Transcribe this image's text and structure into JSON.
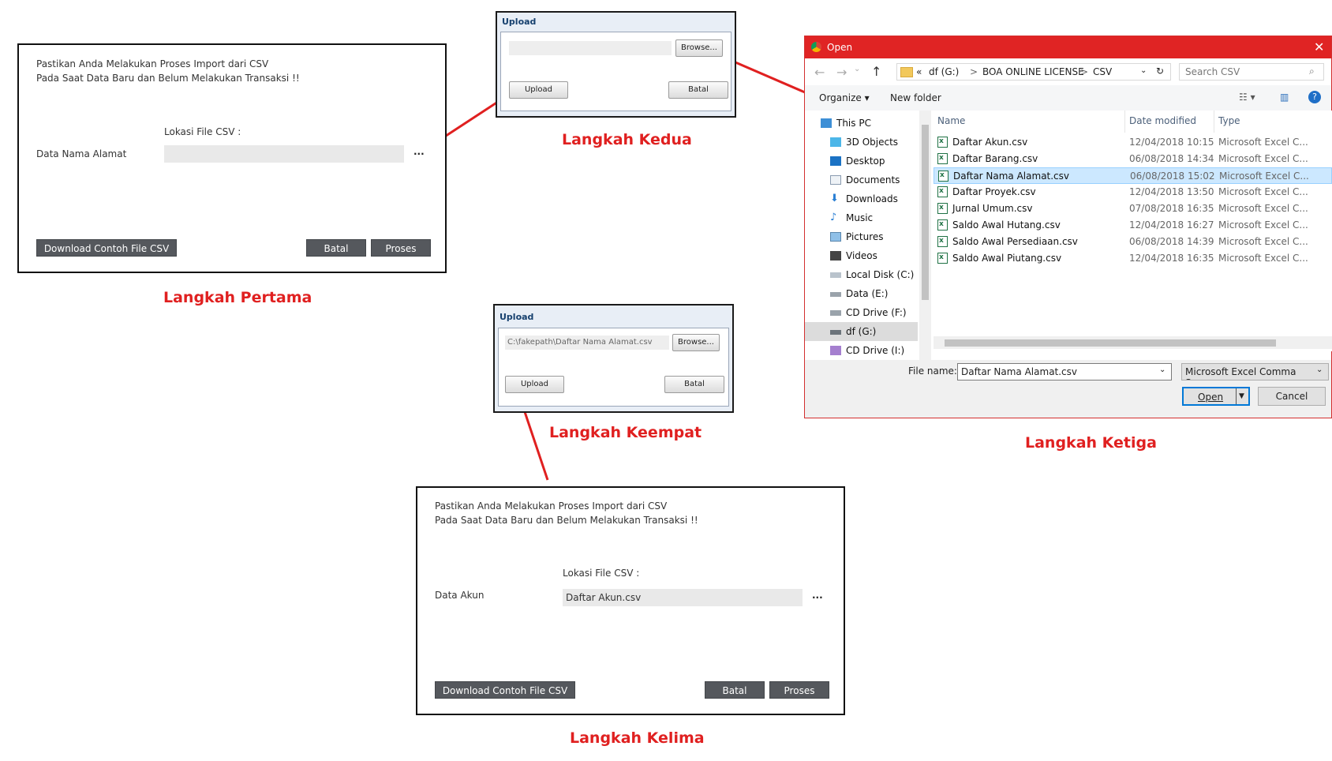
{
  "step1": {
    "line1": "Pastikan Anda Melakukan Proses Import dari CSV",
    "line2": "Pada Saat Data Baru dan Belum Melakukan Transaksi !!",
    "location_label": "Lokasi File CSV :",
    "data_label": "Data Nama Alamat",
    "field_value": "",
    "dots": "...",
    "download_button": "Download Contoh File CSV",
    "cancel_button": "Batal",
    "process_button": "Proses",
    "caption": "Langkah Pertama"
  },
  "step2": {
    "title": "Upload",
    "browse_button": "Browse...",
    "upload_button": "Upload",
    "cancel_button": "Batal",
    "field_value": "",
    "caption": "Langkah Kedua"
  },
  "step3": {
    "window_title": "Open",
    "breadcrumb": [
      "«",
      "df (G:)",
      ">",
      "BOA ONLINE LICENSE",
      ">",
      "CSV"
    ],
    "search_placeholder": "Search CSV",
    "organize": "Organize ▾",
    "new_folder": "New folder",
    "nav_items": [
      {
        "label": "This PC",
        "icon": "pc-icon"
      },
      {
        "label": "3D Objects",
        "icon": "cube-icon"
      },
      {
        "label": "Desktop",
        "icon": "desktop-icon"
      },
      {
        "label": "Documents",
        "icon": "documents-icon"
      },
      {
        "label": "Downloads",
        "icon": "download-icon"
      },
      {
        "label": "Music",
        "icon": "music-icon"
      },
      {
        "label": "Pictures",
        "icon": "pictures-icon"
      },
      {
        "label": "Videos",
        "icon": "videos-icon"
      },
      {
        "label": "Local Disk (C:)",
        "icon": "disk-icon"
      },
      {
        "label": "Data (E:)",
        "icon": "drive-icon"
      },
      {
        "label": "CD Drive (F:)",
        "icon": "cd-icon"
      },
      {
        "label": "df (G:)",
        "icon": "drive-icon"
      },
      {
        "label": "CD Drive (I:) Cur",
        "icon": "cd-icon"
      }
    ],
    "columns": {
      "name": "Name",
      "date": "Date modified",
      "type": "Type"
    },
    "files": [
      {
        "name": "Daftar Akun.csv",
        "date": "12/04/2018 10:15",
        "type": "Microsoft Excel C..."
      },
      {
        "name": "Daftar Barang.csv",
        "date": "06/08/2018 14:34",
        "type": "Microsoft Excel C..."
      },
      {
        "name": "Daftar Nama Alamat.csv",
        "date": "06/08/2018 15:02",
        "type": "Microsoft Excel C..."
      },
      {
        "name": "Daftar Proyek.csv",
        "date": "12/04/2018 13:50",
        "type": "Microsoft Excel C..."
      },
      {
        "name": "Jurnal Umum.csv",
        "date": "07/08/2018 16:35",
        "type": "Microsoft Excel C..."
      },
      {
        "name": "Saldo Awal Hutang.csv",
        "date": "12/04/2018 16:27",
        "type": "Microsoft Excel C..."
      },
      {
        "name": "Saldo Awal Persediaan.csv",
        "date": "06/08/2018 14:39",
        "type": "Microsoft Excel C..."
      },
      {
        "name": "Saldo Awal Piutang.csv",
        "date": "12/04/2018 16:35",
        "type": "Microsoft Excel C..."
      }
    ],
    "selected_index": 2,
    "filename_label": "File name:",
    "filename_value": "Daftar Nama Alamat.csv",
    "filetype_value": "Microsoft Excel Comma Separa",
    "open_button": "Open",
    "cancel_button": "Cancel",
    "caption": "Langkah Ketiga"
  },
  "step4": {
    "title": "Upload",
    "field_value": "C:\\fakepath\\Daftar Nama Alamat.csv",
    "browse_button": "Browse...",
    "upload_button": "Upload",
    "cancel_button": "Batal",
    "caption": "Langkah Keempat"
  },
  "step5": {
    "line1": "Pastikan Anda Melakukan Proses Import dari CSV",
    "line2": "Pada Saat Data Baru dan Belum Melakukan Transaksi !!",
    "location_label": "Lokasi File CSV :",
    "data_label": "Data Akun",
    "field_value": "Daftar Akun.csv",
    "dots": "...",
    "download_button": "Download Contoh File CSV",
    "cancel_button": "Batal",
    "process_button": "Proses",
    "caption": "Langkah Kelima"
  },
  "colors": {
    "accent_red": "#e02020",
    "dark_button": "#55585d",
    "selected_row": "#cce8ff",
    "title_bar": "#e02424"
  }
}
